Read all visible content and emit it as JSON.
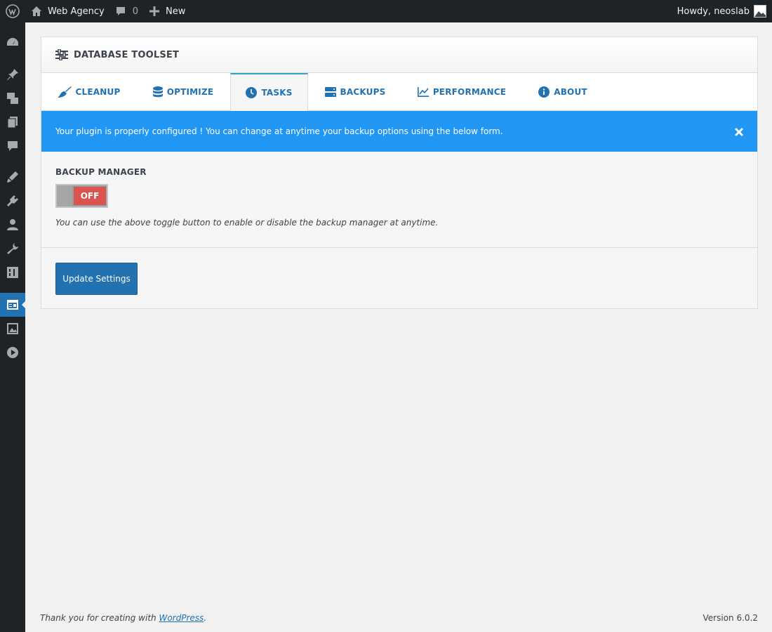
{
  "adminbar": {
    "site_name": "Web Agency",
    "comments_count": "0",
    "new_label": "New",
    "howdy": "Howdy, neoslab"
  },
  "sidebar": {
    "icons": [
      "dashboard-icon",
      "pin-icon",
      "media-icon",
      "pages-icon",
      "comments-icon",
      "appearance-icon",
      "plugins-icon",
      "users-icon",
      "tools-icon",
      "settings-icon",
      "database-toolset-icon",
      "gallery-icon",
      "video-icon"
    ],
    "active": "database-toolset-icon"
  },
  "panel": {
    "title": "DATABASE TOOLSET",
    "tabs": [
      {
        "label": "CLEANUP",
        "icon": "broom-icon"
      },
      {
        "label": "OPTIMIZE",
        "icon": "database-icon"
      },
      {
        "label": "TASKS",
        "icon": "clock-icon",
        "active": true
      },
      {
        "label": "BACKUPS",
        "icon": "hdd-icon"
      },
      {
        "label": "PERFORMANCE",
        "icon": "line-chart-icon"
      },
      {
        "label": "ABOUT",
        "icon": "info-icon"
      }
    ],
    "notice": "Your plugin is properly configured ! You can change at anytime your backup options using the below form.",
    "section_label": "BACKUP MANAGER",
    "toggle_state": "OFF",
    "hint": "You can use the above toggle button to enable or disable the backup manager at anytime.",
    "button_label": "Update Settings"
  },
  "footer": {
    "thanks_prefix": "Thank you for creating with",
    "link_text": "WordPress",
    "thanks_suffix": ".",
    "version": "Version 6.0.2"
  },
  "colors": {
    "accent": "#2271b1",
    "notice": "#2196f3",
    "toggle_off": "#d9534f"
  }
}
